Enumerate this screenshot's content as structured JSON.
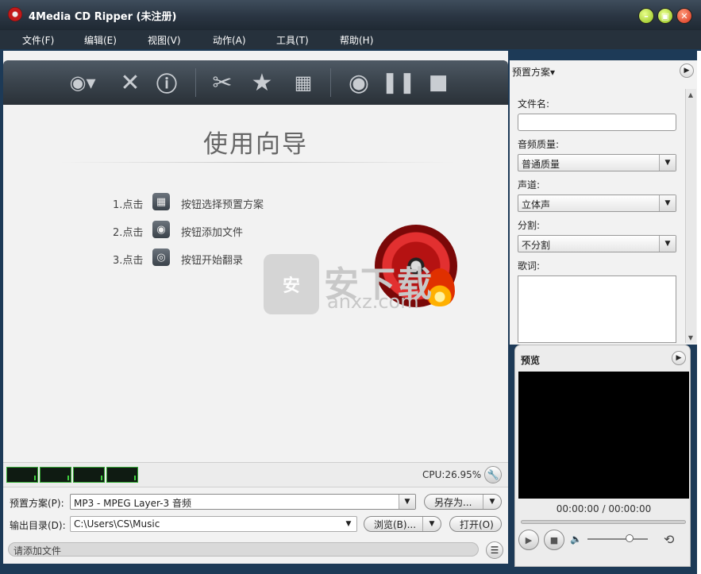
{
  "window": {
    "title": "4Media CD Ripper (未注册)"
  },
  "menu": [
    "文件(F)",
    "编辑(E)",
    "视图(V)",
    "动作(A)",
    "工具(T)",
    "帮助(H)"
  ],
  "wizard": {
    "title": "使用向导",
    "steps": [
      {
        "num": "1.点击",
        "text": "按钮选择预置方案",
        "icon": "preset-film-icon"
      },
      {
        "num": "2.点击",
        "text": "按钮添加文件",
        "icon": "add-cd-icon"
      },
      {
        "num": "3.点击",
        "text": "按钮开始翻录",
        "icon": "rip-disc-icon"
      }
    ]
  },
  "watermark": {
    "box": "安",
    "text": "安下载",
    "sub": "anxz.com"
  },
  "status": {
    "cpu": "CPU:26.95%"
  },
  "bottom": {
    "preset_label": "预置方案(P):",
    "preset_value": "MP3 - MPEG Layer-3 音频",
    "save_as": "另存为...",
    "output_label": "输出目录(D):",
    "output_value": "C:\\Users\\CS\\Music",
    "browse": "浏览(B)...",
    "open": "打开(O)",
    "hint": "请添加文件"
  },
  "right": {
    "header": "预置方案▾",
    "filename_label": "文件名:",
    "filename_value": "",
    "quality_label": "音频质量:",
    "quality_value": "普通质量",
    "channel_label": "声道:",
    "channel_value": "立体声",
    "split_label": "分割:",
    "split_value": "不分割",
    "lyrics_label": "歌词:"
  },
  "preview": {
    "title": "预览",
    "time": "00:00:00 / 00:00:00",
    "volume": 0.7
  }
}
